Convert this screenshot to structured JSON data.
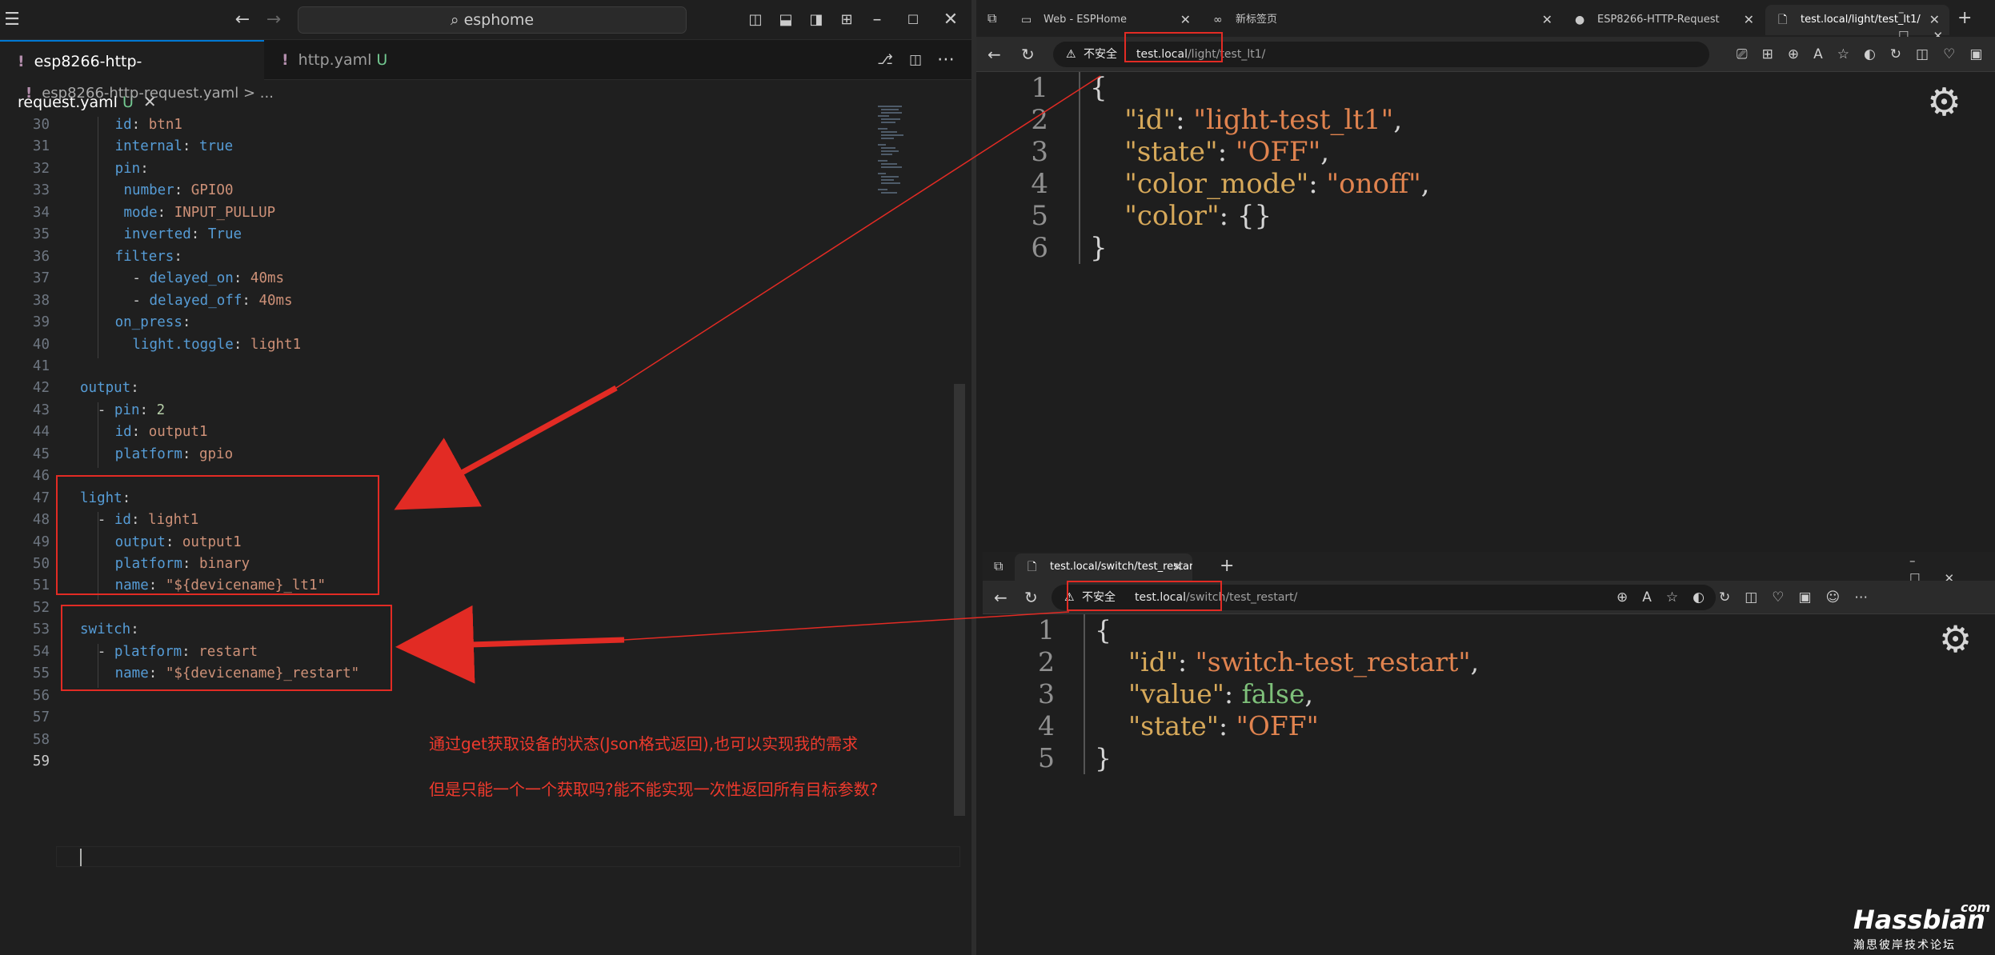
{
  "vscode": {
    "search": "esphome",
    "tabs": [
      {
        "label": "esp8266-http-request.yaml",
        "status": "U"
      },
      {
        "label": "http.yaml",
        "status": "U"
      }
    ],
    "breadcrumb": {
      "file": "esp8266-http-request.yaml",
      "rest": ">  ..."
    },
    "lines": [
      {
        "n": "30",
        "parts": [
          [
            "k",
            "id"
          ],
          [
            "p",
            ": "
          ],
          [
            "v",
            "btn1"
          ]
        ],
        "indent": 4
      },
      {
        "n": "31",
        "parts": [
          [
            "k",
            "internal"
          ],
          [
            "p",
            ": "
          ],
          [
            "b",
            "true"
          ]
        ],
        "indent": 4
      },
      {
        "n": "32",
        "parts": [
          [
            "k",
            "pin"
          ],
          [
            "p",
            ":"
          ]
        ],
        "indent": 4
      },
      {
        "n": "33",
        "parts": [
          [
            "k",
            "number"
          ],
          [
            "p",
            ": "
          ],
          [
            "v",
            "GPIO0"
          ]
        ],
        "indent": 5
      },
      {
        "n": "34",
        "parts": [
          [
            "k",
            "mode"
          ],
          [
            "p",
            ": "
          ],
          [
            "v",
            "INPUT_PULLUP"
          ]
        ],
        "indent": 5
      },
      {
        "n": "35",
        "parts": [
          [
            "k",
            "inverted"
          ],
          [
            "p",
            ": "
          ],
          [
            "b",
            "True"
          ]
        ],
        "indent": 5
      },
      {
        "n": "36",
        "parts": [
          [
            "k",
            "filters"
          ],
          [
            "p",
            ":"
          ]
        ],
        "indent": 4
      },
      {
        "n": "37",
        "parts": [
          [
            "p",
            "- "
          ],
          [
            "k",
            "delayed_on"
          ],
          [
            "p",
            ": "
          ],
          [
            "v",
            "40ms"
          ]
        ],
        "indent": 6
      },
      {
        "n": "38",
        "parts": [
          [
            "p",
            "- "
          ],
          [
            "k",
            "delayed_off"
          ],
          [
            "p",
            ": "
          ],
          [
            "v",
            "40ms"
          ]
        ],
        "indent": 6
      },
      {
        "n": "39",
        "parts": [
          [
            "k",
            "on_press"
          ],
          [
            "p",
            ":"
          ]
        ],
        "indent": 4
      },
      {
        "n": "40",
        "parts": [
          [
            "k",
            "light.toggle"
          ],
          [
            "p",
            ": "
          ],
          [
            "v",
            "light1"
          ]
        ],
        "indent": 6
      },
      {
        "n": "41",
        "parts": [],
        "indent": 0
      },
      {
        "n": "42",
        "parts": [
          [
            "k",
            "output"
          ],
          [
            "p",
            ":"
          ]
        ],
        "indent": 0
      },
      {
        "n": "43",
        "parts": [
          [
            "p",
            "- "
          ],
          [
            "k",
            "pin"
          ],
          [
            "p",
            ": "
          ],
          [
            "n",
            "2"
          ]
        ],
        "indent": 2
      },
      {
        "n": "44",
        "parts": [
          [
            "k",
            "id"
          ],
          [
            "p",
            ": "
          ],
          [
            "v",
            "output1"
          ]
        ],
        "indent": 4
      },
      {
        "n": "45",
        "parts": [
          [
            "k",
            "platform"
          ],
          [
            "p",
            ": "
          ],
          [
            "v",
            "gpio"
          ]
        ],
        "indent": 4
      },
      {
        "n": "46",
        "parts": [],
        "indent": 0
      },
      {
        "n": "47",
        "parts": [
          [
            "k",
            "light"
          ],
          [
            "p",
            ":"
          ]
        ],
        "indent": 0
      },
      {
        "n": "48",
        "parts": [
          [
            "p",
            "- "
          ],
          [
            "k",
            "id"
          ],
          [
            "p",
            ": "
          ],
          [
            "v",
            "light1"
          ]
        ],
        "indent": 2
      },
      {
        "n": "49",
        "parts": [
          [
            "k",
            "output"
          ],
          [
            "p",
            ": "
          ],
          [
            "v",
            "output1"
          ]
        ],
        "indent": 4
      },
      {
        "n": "50",
        "parts": [
          [
            "k",
            "platform"
          ],
          [
            "p",
            ": "
          ],
          [
            "v",
            "binary"
          ]
        ],
        "indent": 4
      },
      {
        "n": "51",
        "parts": [
          [
            "k",
            "name"
          ],
          [
            "p",
            ": "
          ],
          [
            "v",
            "\"${devicename}_lt1\""
          ]
        ],
        "indent": 4
      },
      {
        "n": "52",
        "parts": [],
        "indent": 0
      },
      {
        "n": "53",
        "parts": [
          [
            "k",
            "switch"
          ],
          [
            "p",
            ":"
          ]
        ],
        "indent": 0
      },
      {
        "n": "54",
        "parts": [
          [
            "p",
            "- "
          ],
          [
            "k",
            "platform"
          ],
          [
            "p",
            ": "
          ],
          [
            "v",
            "restart"
          ]
        ],
        "indent": 2
      },
      {
        "n": "55",
        "parts": [
          [
            "k",
            "name"
          ],
          [
            "p",
            ": "
          ],
          [
            "v",
            "\"${devicename}_restart\""
          ]
        ],
        "indent": 4
      },
      {
        "n": "56",
        "parts": [],
        "indent": 0
      },
      {
        "n": "57",
        "parts": [],
        "indent": 0
      },
      {
        "n": "58",
        "parts": [],
        "indent": 0
      },
      {
        "n": "59",
        "parts": [],
        "indent": 0
      }
    ]
  },
  "annotations": {
    "note1": "通过get获取设备的状态(Json格式返回),也可以实现我的需求",
    "note2": "但是只能一个一个获取吗?能不能实现一次性返回所有目标参数?"
  },
  "browser1": {
    "tabs": [
      {
        "label": "Web - ESPHome"
      },
      {
        "label": "新标签页"
      },
      {
        "label": "ESP8266-HTTP-Request"
      },
      {
        "label": "test.local/light/test_lt1/"
      }
    ],
    "security": "不安全",
    "url_host": "test.local",
    "url_path": "/light/test_lt1/",
    "json_lines": [
      {
        "n": "1",
        "parts": [
          [
            "p",
            "{"
          ]
        ]
      },
      {
        "n": "2",
        "parts": [
          [
            "p",
            "    "
          ],
          [
            "k",
            "\"id\""
          ],
          [
            "p",
            ": "
          ],
          [
            "s",
            "\"light-test_lt1\""
          ],
          [
            "p",
            ","
          ]
        ]
      },
      {
        "n": "3",
        "parts": [
          [
            "p",
            "    "
          ],
          [
            "k",
            "\"state\""
          ],
          [
            "p",
            ": "
          ],
          [
            "s",
            "\"OFF\""
          ],
          [
            "p",
            ","
          ]
        ]
      },
      {
        "n": "4",
        "parts": [
          [
            "p",
            "    "
          ],
          [
            "k",
            "\"color_mode\""
          ],
          [
            "p",
            ": "
          ],
          [
            "s",
            "\"onoff\""
          ],
          [
            "p",
            ","
          ]
        ]
      },
      {
        "n": "5",
        "parts": [
          [
            "p",
            "    "
          ],
          [
            "k",
            "\"color\""
          ],
          [
            "p",
            ": {}"
          ]
        ]
      },
      {
        "n": "6",
        "parts": [
          [
            "p",
            "}"
          ]
        ]
      }
    ]
  },
  "browser2": {
    "tabs": [
      {
        "label": "test.local/switch/test_restart/"
      }
    ],
    "security": "不安全",
    "url_host": "test.local",
    "url_path": "/switch/test_restart/",
    "json_lines": [
      {
        "n": "1",
        "parts": [
          [
            "p",
            "{"
          ]
        ]
      },
      {
        "n": "2",
        "parts": [
          [
            "p",
            "    "
          ],
          [
            "k",
            "\"id\""
          ],
          [
            "p",
            ": "
          ],
          [
            "s",
            "\"switch-test_restart\""
          ],
          [
            "p",
            ","
          ]
        ]
      },
      {
        "n": "3",
        "parts": [
          [
            "p",
            "    "
          ],
          [
            "k",
            "\"value\""
          ],
          [
            "p",
            ": "
          ],
          [
            "b",
            "false"
          ],
          [
            "p",
            ","
          ]
        ]
      },
      {
        "n": "4",
        "parts": [
          [
            "p",
            "    "
          ],
          [
            "k",
            "\"state\""
          ],
          [
            "p",
            ": "
          ],
          [
            "s",
            "\"OFF\""
          ]
        ]
      },
      {
        "n": "5",
        "parts": [
          [
            "p",
            "}"
          ]
        ]
      }
    ]
  },
  "watermark": {
    "brand": "Hassbian",
    "com": "com",
    "tagline": "瀚思彼岸技术论坛"
  },
  "icons": [
    "menu-icon",
    "back-arrow-icon",
    "forward-arrow-icon",
    "search-icon",
    "layout-icon",
    "minimize-icon",
    "maximize-icon",
    "close-icon",
    "refresh-icon",
    "warning-icon",
    "gear-icon",
    "star-icon",
    "more-icon",
    "avatar-icon"
  ]
}
